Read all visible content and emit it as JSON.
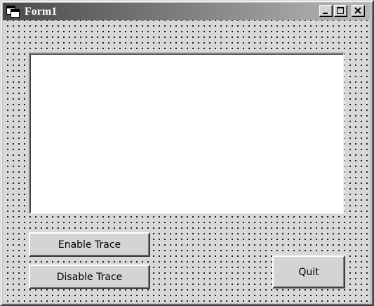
{
  "window": {
    "title": "Form1"
  },
  "titlebar_buttons": {
    "minimize": "minimize-icon",
    "maximize": "maximize-icon",
    "close": "close-icon"
  },
  "textbox": {
    "value": ""
  },
  "buttons": {
    "enable_trace": "Enable Trace",
    "disable_trace": "Disable Trace",
    "quit": "Quit"
  },
  "colors": {
    "titlebar_start": "#4a4a4a",
    "titlebar_end": "#b8b8b8",
    "form_background": "#d8d8d8",
    "textbox_background": "#ffffff"
  }
}
